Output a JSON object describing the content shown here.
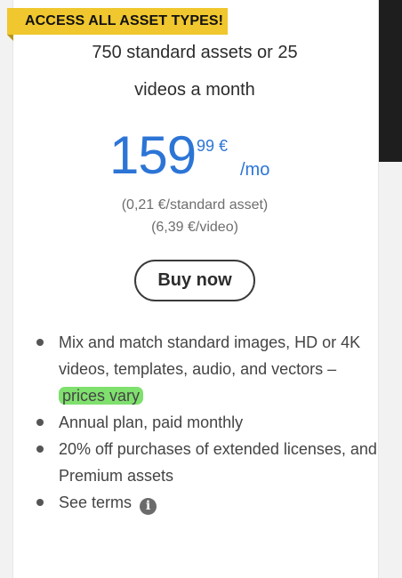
{
  "ribbon": {
    "label": "ACCESS ALL ASSET TYPES!"
  },
  "plan": {
    "subtitle_line1": "750 standard assets or 25",
    "subtitle_line2": "videos a month"
  },
  "price": {
    "integer": "159",
    "decimal": "99 €",
    "unit": "/mo",
    "per_standard_asset": "(0,21 €/standard asset)",
    "per_video": "(6,39 €/video)"
  },
  "buy_button": {
    "label": "Buy now"
  },
  "features": {
    "item1_text": "Mix and match standard images, HD or 4K videos, templates, audio, and vectors –",
    "item1_highlight": "prices vary",
    "item2": "Annual plan, paid monthly",
    "item3": "20% off purchases of extended licenses, and Premium assets",
    "item4": "See terms"
  },
  "icons": {
    "terms": "info-icon"
  },
  "colors": {
    "price": "#2c75d6",
    "ribbon": "#f0c72e",
    "highlight": "#7fe06e"
  }
}
